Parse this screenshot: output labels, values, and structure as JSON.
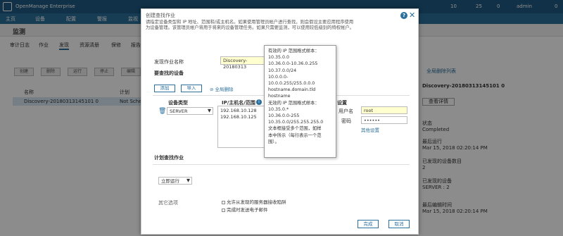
{
  "app": {
    "title": "OpenManage Enterprise"
  },
  "topbar": {
    "count1": "10",
    "count2": "25",
    "count3": "0",
    "user": "admin",
    "count4": "0"
  },
  "menu": {
    "home": "主页",
    "devices": "设备",
    "config": "配置",
    "alerts": "警报",
    "monitor": "监视",
    "app_settings": "应用程序设置"
  },
  "page": {
    "title": "监测"
  },
  "tabs": [
    "审计日志",
    "作业",
    "发现",
    "资源清册",
    "保修",
    "报告"
  ],
  "bg_buttons": [
    "创建",
    "删除",
    "运行",
    "停止",
    "编辑"
  ],
  "bg_table": {
    "col_name": "名称",
    "col_schedule": "计划",
    "row_name": "Discovery-20180313145101 0",
    "row_schedule": "Not Sched"
  },
  "right_panel": {
    "expand_all": "全局删除列表",
    "job_name": "Discovery-20180313145101 0",
    "view_details": "查看详情",
    "status_label": "状态",
    "status_value": "Completed",
    "last_run_label": "最后运行",
    "last_run_value": "Mar 15, 2018 02:20:14 PM",
    "discovered_label": "已发现的设备数目",
    "discovered_value": "2",
    "devices_label": "已发现的设备",
    "devices_value": "SERVER : 2",
    "last_updated_label": "最后编辑时间",
    "last_updated_value": "Mar 15, 2018 02:20:14 PM"
  },
  "modal": {
    "title": "创建查找作业",
    "description": "请指定设备类型和 IP 地址、范围和/或主机名。如果使用管理员帐户进行查找，则会假设主要应用程序使用为设备管理。该管理员帐户将用于将来的设备管理任务。如果只需要监测，可以使用较低级别的特权帐户。",
    "job_name_label": "发现作业名称",
    "job_name_value": "Discovery-20180313",
    "devices_to_find": "要查找的设备",
    "add_button": "添加",
    "import_button": "导入",
    "remove_all": "全局删除",
    "device_type_label": "设备类型",
    "device_type_value": "SERVER",
    "ip_label": "IP/主机名/范围",
    "ip_values": [
      "192.168.10.128",
      "192.168.10.125"
    ],
    "settings_label": "设置",
    "username_label": "用户名",
    "username_value": "root",
    "password_label": "密码",
    "password_value": "••••••",
    "other_settings": "其他设置",
    "schedule_label": "计划查找作业",
    "run_now": "立即运行",
    "other_options_label": "其它选项",
    "option1": "允许从发现的服务器接收陷阱",
    "option2": "完成时发送电子邮件",
    "finish_button": "完成",
    "cancel_button": "取消"
  },
  "tooltip": {
    "lines": [
      "有效的 IP 范围格式样本：",
      "10.35.0.0",
      "10.36.0.0-10.36.0.255",
      "10.37.0.0/24",
      "10.0.0.0-",
      "10.0.0.255/255.0.0.0",
      "hostname.domain.tld",
      "hostname",
      "无效的 IP 范围格式样本：",
      "10.35.0.*",
      "10.36.0.0-255",
      "10.35.0.0/255.255.255.0",
      "文本框接受多个范围，如样",
      "本中所示（每行表示一个范",
      "围）。"
    ]
  }
}
